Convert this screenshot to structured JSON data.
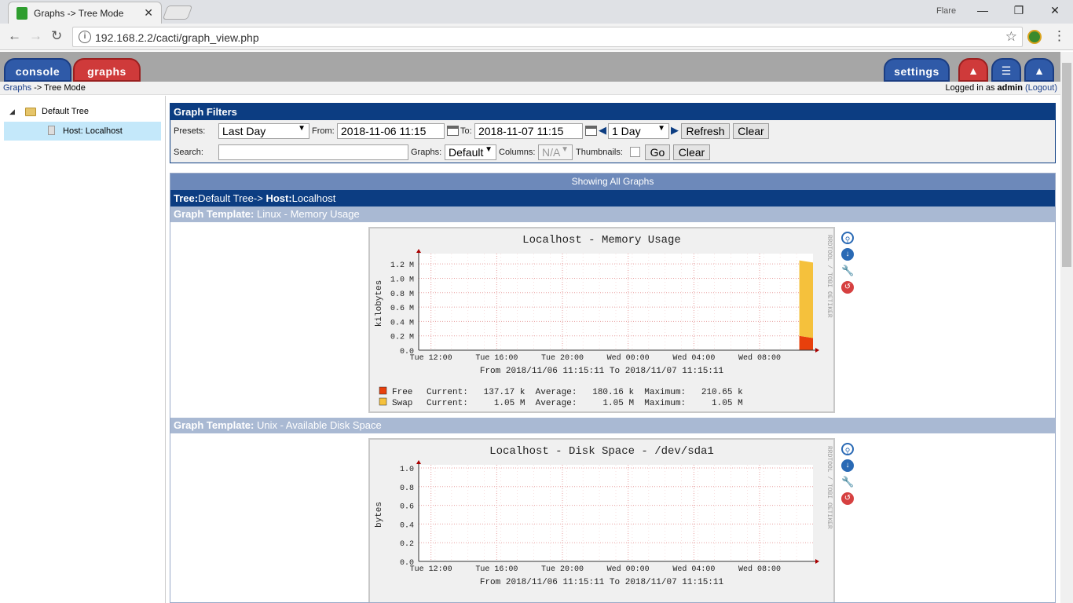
{
  "browser": {
    "tab_title": "Graphs -> Tree Mode",
    "tab_close": "✕",
    "window_user": "Flare",
    "url": "192.168.2.2/cacti/graph_view.php"
  },
  "nav": {
    "console": "console",
    "graphs": "graphs",
    "settings": "settings"
  },
  "breadcrumb": {
    "graphs_link": "Graphs",
    "rest": "-> Tree Mode"
  },
  "login": {
    "prefix": "Logged in as",
    "user": "admin",
    "logout": "(Logout)"
  },
  "sidebar": {
    "root": "Default Tree",
    "host": "Host: Localhost"
  },
  "filters": {
    "title": "Graph Filters",
    "presets_label": "Presets:",
    "presets_value": "Last Day",
    "from_label": "From:",
    "from_value": "2018-11-06 11:15",
    "to_label": "To:",
    "to_value": "2018-11-07 11:15",
    "span_value": "1 Day",
    "refresh": "Refresh",
    "clear": "Clear",
    "search_label": "Search:",
    "search_value": "",
    "graphs_label": "Graphs:",
    "graphs_value": "Default",
    "columns_label": "Columns:",
    "columns_value": "N/A",
    "thumbnails_label": "Thumbnails:",
    "go": "Go",
    "clear2": "Clear"
  },
  "results": {
    "showing": "Showing All Graphs",
    "tree_label": "Tree:",
    "tree_value": "Default Tree->",
    "host_label": "Host:",
    "host_value": "Localhost"
  },
  "graphs": [
    {
      "template_label": "Graph Template:",
      "template_value": "Linux - Memory Usage",
      "title": "Localhost - Memory Usage",
      "ylabel": "kilobytes",
      "side_text": "RRDTOOL / TOBI OETIKER",
      "range": "From 2018/11/06 11:15:11 To 2018/11/07 11:15:11",
      "legend": [
        {
          "name": "Free",
          "color": "#e8400c",
          "text": "Current:   137.17 k  Average:   180.16 k  Maximum:   210.65 k"
        },
        {
          "name": "Swap",
          "color": "#f5c13c",
          "text": "Current:     1.05 M  Average:     1.05 M  Maximum:     1.05 M"
        }
      ]
    },
    {
      "template_label": "Graph Template:",
      "template_value": "Unix - Available Disk Space",
      "title": "Localhost - Disk Space - /dev/sda1",
      "ylabel": "bytes",
      "side_text": "RRDTOOL / TOBI OETIKER",
      "range": "From 2018/11/06 11:15:11 To 2018/11/07 11:15:11"
    }
  ],
  "chart_data": [
    {
      "type": "area",
      "title": "Localhost - Memory Usage",
      "ylabel": "kilobytes",
      "yticks": [
        "0.0",
        "0.2 M",
        "0.4 M",
        "0.6 M",
        "0.8 M",
        "1.0 M",
        "1.2 M"
      ],
      "xticks": [
        "Tue 12:00",
        "Tue 16:00",
        "Tue 20:00",
        "Wed 00:00",
        "Wed 04:00",
        "Wed 08:00"
      ],
      "ylim": [
        0,
        1300000
      ],
      "series": [
        {
          "name": "Free",
          "color": "#e8400c",
          "x": [
            "Wed 10:25",
            "Wed 11:15"
          ],
          "values": [
            200000,
            170000
          ]
        },
        {
          "name": "Swap",
          "color": "#f5c13c",
          "x": [
            "Wed 10:25",
            "Wed 11:15"
          ],
          "values": [
            1050000,
            1050000
          ]
        }
      ]
    },
    {
      "type": "line",
      "title": "Localhost - Disk Space - /dev/sda1",
      "ylabel": "bytes",
      "yticks": [
        "0.0",
        "0.2",
        "0.4",
        "0.6",
        "0.8",
        "1.0"
      ],
      "xticks": [
        "Tue 12:00",
        "Tue 16:00",
        "Tue 20:00",
        "Wed 00:00",
        "Wed 04:00",
        "Wed 08:00"
      ],
      "ylim": [
        0,
        1.0
      ],
      "series": []
    }
  ]
}
